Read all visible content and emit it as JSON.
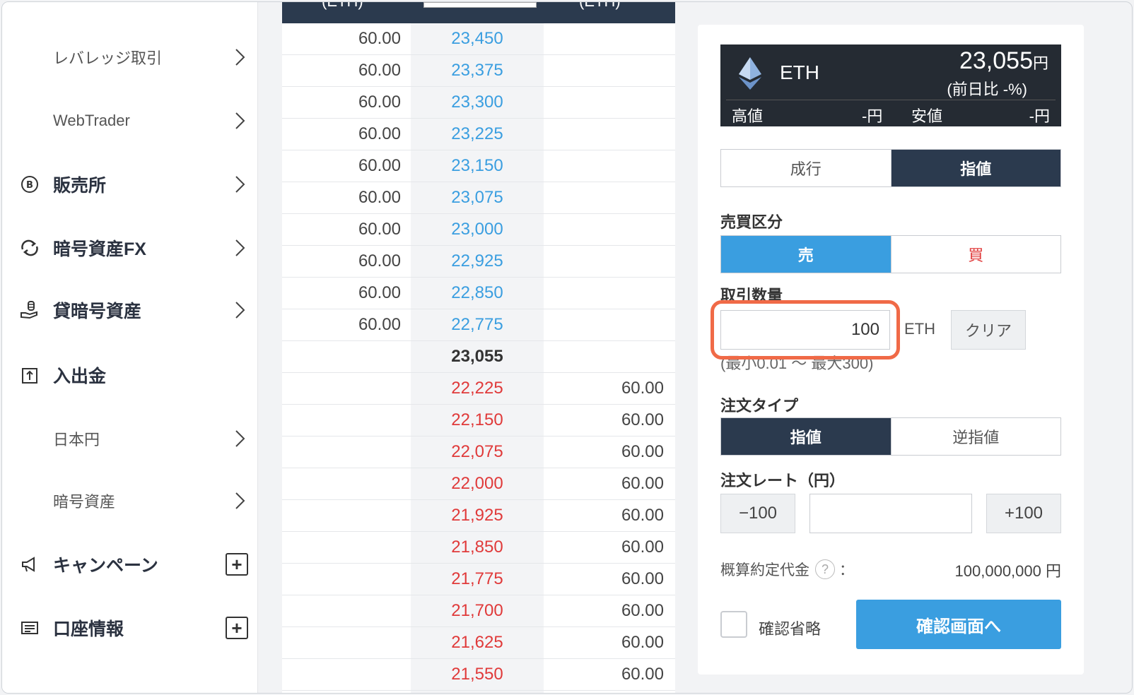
{
  "sidebar": {
    "items": [
      {
        "label": "レバレッジ取引",
        "icon": ""
      },
      {
        "label": "WebTrader",
        "icon": ""
      },
      {
        "label": "販売所",
        "icon": "bitcoin-circle-icon"
      },
      {
        "label": "暗号資産FX",
        "icon": "exchange-arrows-icon"
      },
      {
        "label": "貸暗号資産",
        "icon": "lending-hand-icon"
      },
      {
        "label": "入出金",
        "icon": "deposit-box-icon"
      },
      {
        "label": "日本円",
        "icon": ""
      },
      {
        "label": "暗号資産",
        "icon": ""
      },
      {
        "label": "キャンペーン",
        "icon": "megaphone-icon"
      },
      {
        "label": "口座情報",
        "icon": "id-card-icon"
      }
    ]
  },
  "orderbook": {
    "header": {
      "left": "(ETH)",
      "right": "(ETH)"
    },
    "asks": [
      {
        "qty": "60.00",
        "price": "23,450"
      },
      {
        "qty": "60.00",
        "price": "23,375"
      },
      {
        "qty": "60.00",
        "price": "23,300"
      },
      {
        "qty": "60.00",
        "price": "23,225"
      },
      {
        "qty": "60.00",
        "price": "23,150"
      },
      {
        "qty": "60.00",
        "price": "23,075"
      },
      {
        "qty": "60.00",
        "price": "23,000"
      },
      {
        "qty": "60.00",
        "price": "22,925"
      },
      {
        "qty": "60.00",
        "price": "22,850"
      },
      {
        "qty": "60.00",
        "price": "22,775"
      }
    ],
    "current": "23,055",
    "bids": [
      {
        "price": "22,225",
        "qty": "60.00"
      },
      {
        "price": "22,150",
        "qty": "60.00"
      },
      {
        "price": "22,075",
        "qty": "60.00"
      },
      {
        "price": "22,000",
        "qty": "60.00"
      },
      {
        "price": "21,925",
        "qty": "60.00"
      },
      {
        "price": "21,850",
        "qty": "60.00"
      },
      {
        "price": "21,775",
        "qty": "60.00"
      },
      {
        "price": "21,700",
        "qty": "60.00"
      },
      {
        "price": "21,625",
        "qty": "60.00"
      },
      {
        "price": "21,550",
        "qty": "60.00"
      }
    ]
  },
  "ticker": {
    "symbol": "ETH",
    "price": "23,055",
    "price_unit": "円",
    "change": "(前日比 -%)",
    "high_label": "高値",
    "high_value": "-円",
    "low_label": "安値",
    "low_value": "-円"
  },
  "order": {
    "order_kind": {
      "market": "成行",
      "limit": "指値",
      "selected": "指値"
    },
    "side_label": "売買区分",
    "side": {
      "sell": "売",
      "buy": "買",
      "selected": "売"
    },
    "qty_label": "取引数量",
    "qty_value": "100",
    "qty_unit": "ETH",
    "clear": "クリア",
    "qty_range": "(最小0.01 〜 最大300)",
    "type_label": "注文タイプ",
    "type": {
      "limit": "指値",
      "stop": "逆指値",
      "selected": "指値"
    },
    "rate_label": "注文レート（円）",
    "minus": "−100",
    "plus": "+100",
    "rate_value": "",
    "estimate_label": "概算約定代金",
    "estimate_colon": "：",
    "estimate_value": "100,000,000 円",
    "skip_confirm": "確認省略",
    "confirm": "確認画面へ"
  },
  "colors": {
    "accent": "#3a9ee0",
    "dark": "#2b3a4e",
    "sell": "#3a9ee0",
    "buy": "#e03a3a",
    "highlight": "#f06a47"
  }
}
